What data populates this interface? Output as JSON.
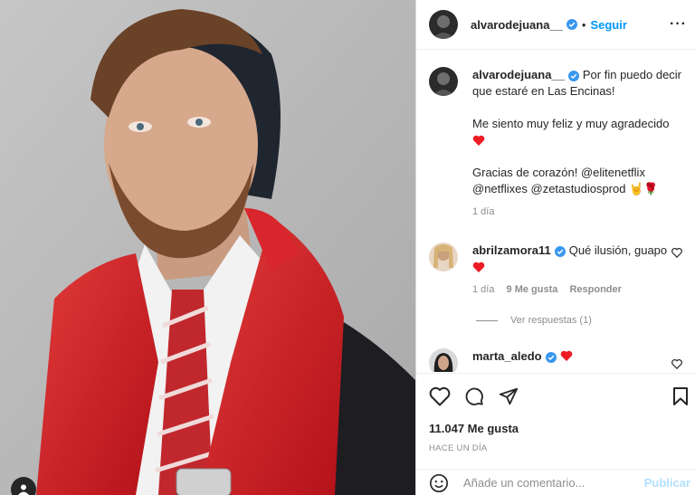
{
  "post": {
    "author": "alvarodejuana__",
    "follow_label": "Seguir",
    "dot": "•",
    "more_label": "···"
  },
  "caption": {
    "username": "alvarodejuana__",
    "line1": "Por fin puedo decir que estaré en Las Encinas!",
    "line2": "Me siento muy feliz y muy agradecido",
    "line3": "Gracias de corazón! @elitenetflix @netflixes @zetastudiosprod",
    "emoji_end": "🤘🌹",
    "time": "1 día"
  },
  "comments": [
    {
      "username": "abrilzamora11",
      "text": "Qué ilusión, guapo",
      "time": "1 día",
      "likes": "9 Me gusta",
      "reply_label": "Responder",
      "replies_label": "Ver respuestas (1)"
    },
    {
      "username": "marta_aledo",
      "text": ""
    }
  ],
  "actions": {
    "likes_count": "11.047 Me gusta",
    "posted_time": "HACE UN DÍA"
  },
  "add_comment": {
    "placeholder": "Añade un comentario...",
    "publish_label": "Publicar"
  },
  "colors": {
    "accent": "#0095f6",
    "verified": "#3897f0",
    "heart": "#ed1c24",
    "muted": "#8e8e8e"
  },
  "icons": [
    "verified-badge-icon",
    "more-options-icon",
    "heart-icon",
    "comment-icon",
    "share-icon",
    "bookmark-icon",
    "emoji-icon",
    "tag-user-icon"
  ]
}
